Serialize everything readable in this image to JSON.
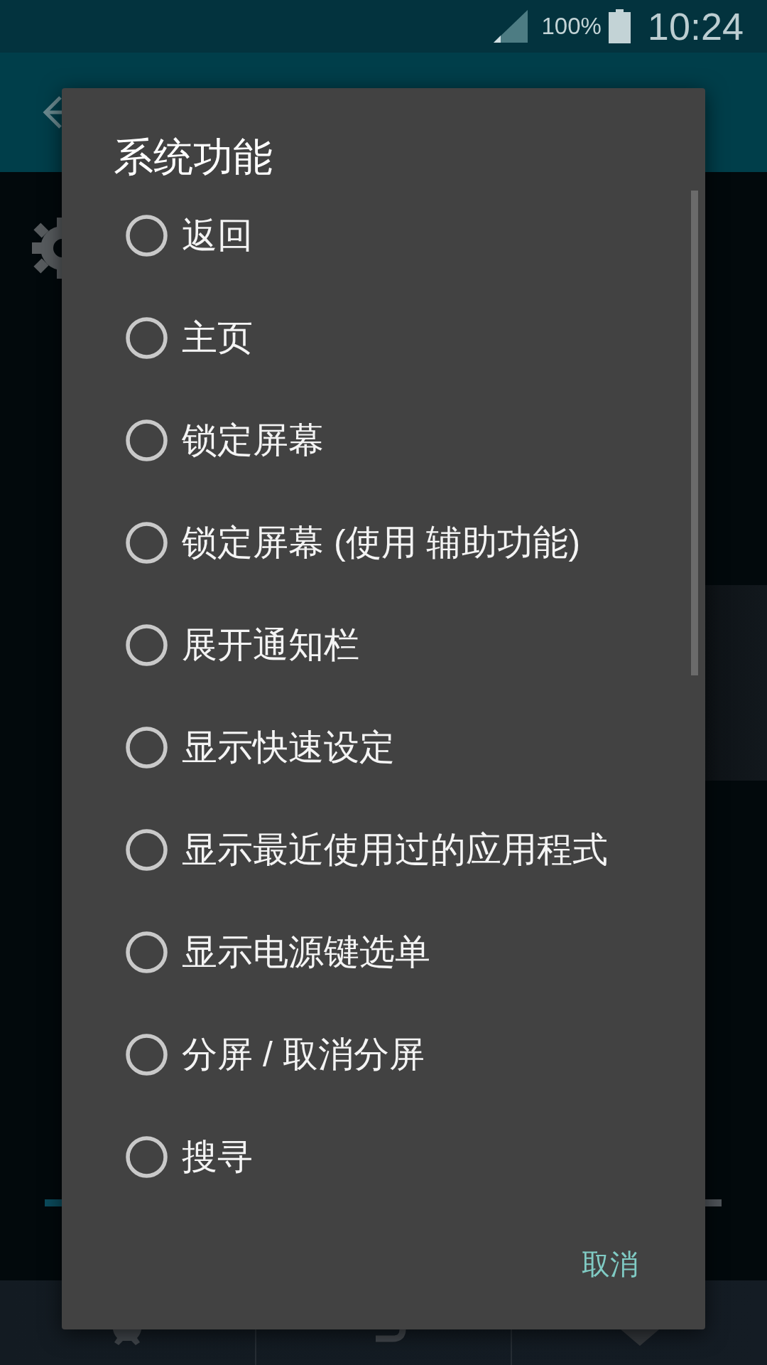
{
  "status_bar": {
    "battery_percent": "100%",
    "time": "10:24"
  },
  "dialog": {
    "title": "系统功能",
    "options": [
      {
        "label": "返回",
        "selected": false
      },
      {
        "label": "主页",
        "selected": false
      },
      {
        "label": "锁定屏幕",
        "selected": false
      },
      {
        "label": "锁定屏幕 (使用 辅助功能)",
        "selected": false
      },
      {
        "label": "展开通知栏",
        "selected": false
      },
      {
        "label": "显示快速设定",
        "selected": false
      },
      {
        "label": "显示最近使用过的应用程式",
        "selected": false
      },
      {
        "label": "显示电源键选单",
        "selected": false
      },
      {
        "label": "分屏 / 取消分屏",
        "selected": false
      },
      {
        "label": "搜寻",
        "selected": false
      }
    ],
    "buttons": [
      {
        "label": "取消"
      }
    ]
  }
}
